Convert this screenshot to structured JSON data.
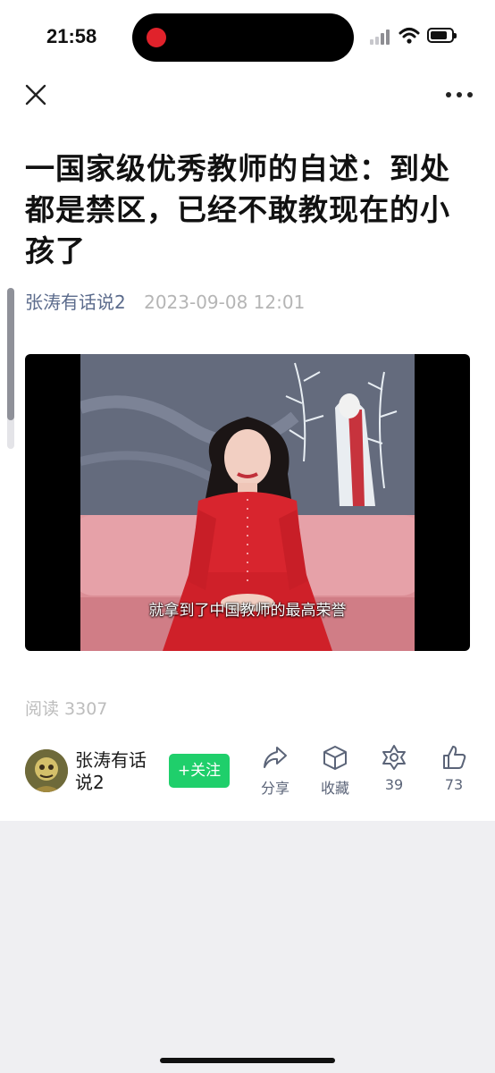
{
  "status_bar": {
    "time": "21:58"
  },
  "article": {
    "title": "一国家级优秀教师的自述：到处都是禁区，已经不敢教现在的小孩了",
    "author": "张涛有话说2",
    "date": "2023-09-08 12:01",
    "video_caption": "就拿到了中国教师的最高荣誉",
    "reads": "阅读 3307"
  },
  "bottom_bar": {
    "author_name": "张涛有话说2",
    "follow_label": "+关注",
    "share_label": "分享",
    "favorite_label": "收藏",
    "wow_count": "39",
    "like_count": "73"
  },
  "colors": {
    "follow_green": "#1fcf6b",
    "author_link": "#5b6b8c",
    "icon_gray": "#5b6478"
  }
}
